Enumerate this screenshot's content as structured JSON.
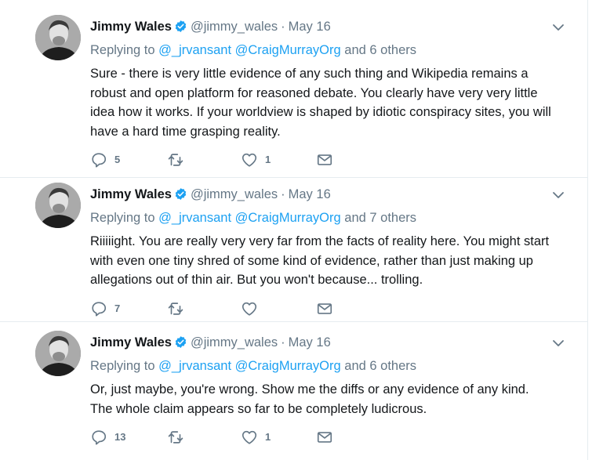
{
  "colors": {
    "accent": "#1da1f2",
    "secondary_text": "#657786",
    "primary_text": "#14171a",
    "divider": "#e6ecf0"
  },
  "icons": {
    "reply": "reply-icon",
    "retweet": "retweet-icon",
    "like": "heart-icon",
    "dm": "envelope-icon",
    "caret": "chevron-down-icon",
    "verified": "verified-badge-icon"
  },
  "tweets": [
    {
      "name": "Jimmy Wales",
      "handle": "@jimmy_wales",
      "separator": "·",
      "time": "May 16",
      "replying_prefix": "Replying to",
      "mention_1": "@_jrvansant",
      "mention_2": "@CraigMurrayOrg",
      "others": "and 6 others",
      "lines": [
        "Sure - there is very little evidence of any such thing and Wikipedia remains a",
        "robust and open platform for reasoned debate.  You clearly have very very little",
        "idea how it works.  If your worldview is shaped by idiotic conspiracy sites, you will",
        "have a hard time grasping reality."
      ],
      "reply_count": "5",
      "retweet_count": "",
      "like_count": "1"
    },
    {
      "name": "Jimmy Wales",
      "handle": "@jimmy_wales",
      "separator": "·",
      "time": "May 16",
      "replying_prefix": "Replying to",
      "mention_1": "@_jrvansant",
      "mention_2": "@CraigMurrayOrg",
      "others": "and 7 others",
      "lines": [
        "Riiiiight.  You are really very very far from the facts of reality here.  You might start",
        "with even one tiny shred of some kind of evidence, rather than just making up",
        "allegations out of thin air.  But you won't because... trolling."
      ],
      "reply_count": "7",
      "retweet_count": "",
      "like_count": ""
    },
    {
      "name": "Jimmy Wales",
      "handle": "@jimmy_wales",
      "separator": "·",
      "time": "May 16",
      "replying_prefix": "Replying to",
      "mention_1": "@_jrvansant",
      "mention_2": "@CraigMurrayOrg",
      "others": "and 6 others",
      "lines": [
        "Or, just maybe, you're wrong.  Show me the diffs or any evidence of any kind.",
        "The whole claim appears so far to be completely ludicrous."
      ],
      "reply_count": "13",
      "retweet_count": "",
      "like_count": "1"
    }
  ]
}
